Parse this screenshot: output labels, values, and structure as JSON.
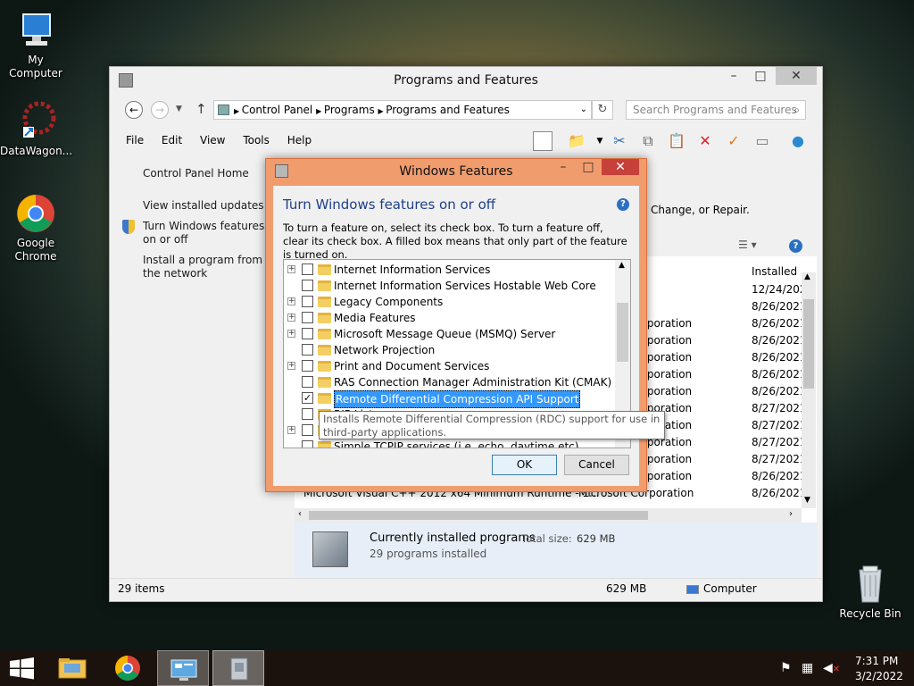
{
  "desktop": {
    "icons": [
      {
        "label": "My Computer"
      },
      {
        "label": "DataWagon..."
      },
      {
        "label": "Google Chrome"
      },
      {
        "label": "Recycle Bin"
      }
    ]
  },
  "programs_window": {
    "title": "Programs and Features",
    "nav": {
      "back": "←",
      "forward": "→",
      "up": "↑"
    },
    "breadcrumb": [
      "Control Panel",
      "Programs",
      "Programs and Features"
    ],
    "search_placeholder": "Search Programs and Features",
    "menu": [
      "File",
      "Edit",
      "View",
      "Tools",
      "Help"
    ],
    "left_links": {
      "home": "Control Panel Home",
      "updates": "View installed updates",
      "features": "Turn Windows features on or off",
      "install": "Install a program from the network"
    },
    "header_text": "Change, or Repair.",
    "column_installed": "Installed",
    "rows": [
      {
        "publisher": "",
        "date": "12/24/202"
      },
      {
        "publisher": "",
        "date": "8/26/2021"
      },
      {
        "publisher": "rporation",
        "date": "8/26/2021"
      },
      {
        "publisher": "rporation",
        "date": "8/26/2021"
      },
      {
        "publisher": "rporation",
        "date": "8/26/2021"
      },
      {
        "publisher": "rporation",
        "date": "8/26/2021"
      },
      {
        "publisher": "rporation",
        "date": "8/26/2021"
      },
      {
        "publisher": "rporation",
        "date": "8/27/2021"
      },
      {
        "publisher": "rporation",
        "date": "8/27/2021"
      },
      {
        "publisher": "rporation",
        "date": "8/27/2021"
      },
      {
        "publisher": "rporation",
        "date": "8/27/2021"
      },
      {
        "publisher": "rporation",
        "date": "8/26/2021"
      }
    ],
    "last_row": {
      "name": "Microsoft Visual C++ 2012 x64 Minimum Runtime - 1...",
      "publisher": "Microsoft Corporation",
      "date": "8/26/2021"
    },
    "summary": {
      "title": "Currently installed programs",
      "size_label": "Total size:",
      "size": "629 MB",
      "count": "29 programs installed"
    },
    "status": {
      "items": "29 items",
      "size": "629 MB",
      "location": "Computer"
    }
  },
  "features_dialog": {
    "title": "Windows Features",
    "heading": "Turn Windows features on or off",
    "description": "To turn a feature on, select its check box. To turn a feature off, clear its check box. A filled box means that only part of the feature is turned on.",
    "features": [
      {
        "label": "Internet Information Services",
        "expandable": true,
        "checked": false
      },
      {
        "label": "Internet Information Services Hostable Web Core",
        "expandable": false,
        "checked": false
      },
      {
        "label": "Legacy Components",
        "expandable": true,
        "checked": false
      },
      {
        "label": "Media Features",
        "expandable": true,
        "checked": false
      },
      {
        "label": "Microsoft Message Queue (MSMQ) Server",
        "expandable": true,
        "checked": false
      },
      {
        "label": "Network Projection",
        "expandable": false,
        "checked": false
      },
      {
        "label": "Print and Document Services",
        "expandable": true,
        "checked": false
      },
      {
        "label": "RAS Connection Manager Administration Kit (CMAK)",
        "expandable": false,
        "checked": false
      },
      {
        "label": "Remote Differential Compression API Support",
        "expandable": false,
        "checked": true,
        "selected": true
      },
      {
        "label": "RIP Listener",
        "expandable": false,
        "checked": false
      },
      {
        "label": "",
        "expandable": true,
        "checked": false
      },
      {
        "label": "Simple TCPIP services (i.e. echo, daytime etc)",
        "expandable": false,
        "checked": false
      }
    ],
    "tooltip": "Installs Remote Differential Compression (RDC) support for use in third-party applications.",
    "ok_label": "OK",
    "cancel_label": "Cancel"
  },
  "taskbar": {
    "time": "7:31 PM",
    "date": "3/2/2022"
  }
}
